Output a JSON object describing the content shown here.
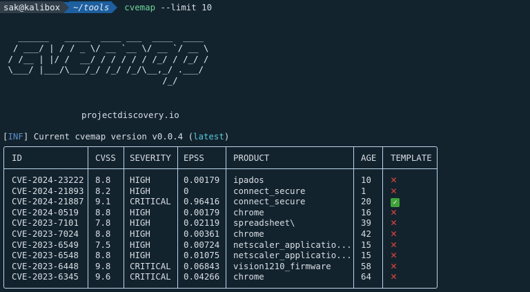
{
  "prompt": {
    "user": "sak@kalibox",
    "dir": "~/tools",
    "command_bin": "cvemap",
    "command_args": " --limit 10"
  },
  "banner_lines": [
    "   ______   _____  ____ ___  ____  ____",
    "  / ___/ | / / _ \\/ __ `__ \\/ __ `/ __ \\",
    " / /__ | |/ /  __/ / / / / / /_/ / /_/ /",
    " \\___/ |___/\\___/_/ /_/ /_/\\__,_/ .___/",
    "                               /_/"
  ],
  "site": "projectdiscovery.io",
  "version": {
    "prefix": "[",
    "tag": "INF",
    "mid": "] Current cvemap version v0.0.4 (",
    "status": "latest",
    "suffix": ")"
  },
  "table": {
    "headers": [
      "ID",
      "CVSS",
      "SEVERITY",
      "EPSS",
      "PRODUCT",
      "AGE",
      "TEMPLATE"
    ],
    "rows": [
      {
        "id": "CVE-2024-23222",
        "cvss": "8.8",
        "severity": "HIGH",
        "epss": "0.00179",
        "product": "ipados",
        "age": "10",
        "template": "❌"
      },
      {
        "id": "CVE-2024-21893",
        "cvss": "8.2",
        "severity": "HIGH",
        "epss": "0",
        "product": "connect_secure",
        "age": "1",
        "template": "❌"
      },
      {
        "id": "CVE-2024-21887",
        "cvss": "9.1",
        "severity": "CRITICAL",
        "epss": "0.96416",
        "product": "connect_secure",
        "age": "20",
        "template": "✅"
      },
      {
        "id": "CVE-2024-0519",
        "cvss": "8.8",
        "severity": "HIGH",
        "epss": "0.00179",
        "product": "chrome",
        "age": "16",
        "template": "❌"
      },
      {
        "id": "CVE-2023-7101",
        "cvss": "7.8",
        "severity": "HIGH",
        "epss": "0.02119",
        "product": "spreadsheet\\",
        "age": "39",
        "template": "❌"
      },
      {
        "id": "CVE-2023-7024",
        "cvss": "8.8",
        "severity": "HIGH",
        "epss": "0.00361",
        "product": "chrome",
        "age": "42",
        "template": "❌"
      },
      {
        "id": "CVE-2023-6549",
        "cvss": "7.5",
        "severity": "HIGH",
        "epss": "0.00724",
        "product": "netscaler_applicatio...",
        "age": "15",
        "template": "❌"
      },
      {
        "id": "CVE-2023-6548",
        "cvss": "8.8",
        "severity": "HIGH",
        "epss": "0.01075",
        "product": "netscaler_applicatio...",
        "age": "15",
        "template": "❌"
      },
      {
        "id": "CVE-2023-6448",
        "cvss": "9.8",
        "severity": "CRITICAL",
        "epss": "0.06843",
        "product": "vision1210_firmware",
        "age": "58",
        "template": "❌"
      },
      {
        "id": "CVE-2023-6345",
        "cvss": "9.6",
        "severity": "CRITICAL",
        "epss": "0.04266",
        "product": "chrome",
        "age": "64",
        "template": "❌"
      }
    ]
  }
}
